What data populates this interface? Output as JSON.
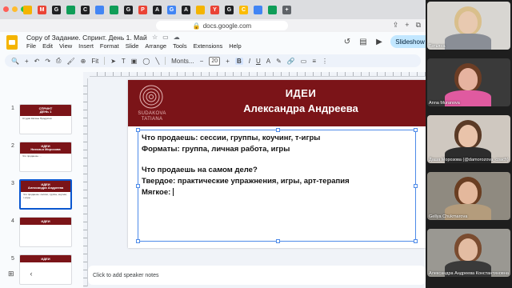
{
  "browser": {
    "url": "docs.google.com",
    "tabs": [
      {
        "color": "#f4b400",
        "glyph": ""
      },
      {
        "color": "#ea4335",
        "glyph": "M"
      },
      {
        "color": "#202124",
        "glyph": "G"
      },
      {
        "color": "#0f9d58",
        "glyph": ""
      },
      {
        "color": "#202124",
        "glyph": "C"
      },
      {
        "color": "#4285f4",
        "glyph": ""
      },
      {
        "color": "#0f9d58",
        "glyph": ""
      },
      {
        "color": "#202124",
        "glyph": "G"
      },
      {
        "color": "#ea4335",
        "glyph": "P"
      },
      {
        "color": "#202124",
        "glyph": "A"
      },
      {
        "color": "#4285f4",
        "glyph": "G"
      },
      {
        "color": "#202124",
        "glyph": "A"
      },
      {
        "color": "#f4b400",
        "glyph": ""
      },
      {
        "color": "#ea4335",
        "glyph": "Y"
      },
      {
        "color": "#202124",
        "glyph": "G"
      },
      {
        "color": "#fbbc04",
        "glyph": "C"
      },
      {
        "color": "#4285f4",
        "glyph": ""
      },
      {
        "color": "#0f9d58",
        "glyph": ""
      },
      {
        "color": "#5f6368",
        "glyph": "+"
      }
    ]
  },
  "doc": {
    "title": "Copy of Задание. Спринт. День 1. Май",
    "menu": [
      "File",
      "Edit",
      "View",
      "Insert",
      "Format",
      "Slide",
      "Arrange",
      "Tools",
      "Extensions",
      "Help"
    ],
    "slideshow_label": "Slideshow"
  },
  "toolbar": {
    "zoom": "Fit",
    "font": "Monts...",
    "font_size": "20",
    "bold": "B"
  },
  "filmstrip": [
    {
      "num": "1",
      "title": "СПРИНТ",
      "subtitle": "ДЕНЬ 1",
      "body": "Студия Катины Продуктов"
    },
    {
      "num": "2",
      "title": "ИДЕИ",
      "subtitle": "Наталья Морозова",
      "body": "Что продаешь: ..."
    },
    {
      "num": "3",
      "title": "ИДЕИ",
      "subtitle": "Александра Андреева",
      "body": "Что продаешь: сессии, группы, коучинг, т-игры"
    },
    {
      "num": "4",
      "title": "ИДЕИ",
      "subtitle": "",
      "body": ""
    },
    {
      "num": "5",
      "title": "ИДЕИ",
      "subtitle": "",
      "body": ""
    }
  ],
  "slide": {
    "brand_line1": "SUDAKOVA",
    "brand_line2": "TATIANA",
    "heading": "ИДЕИ",
    "name": "Александра Андреева",
    "lines": [
      "Что продаешь: сессии, группы, коучинг, т-игры",
      "Форматы: группа, личная работа, игры",
      "",
      "Что продаешь на самом деле?",
      "Твердое: практические упражнения, игры, арт-терапия",
      "Мягкое:"
    ]
  },
  "notes_placeholder": "Click to add speaker notes",
  "participants": [
    {
      "name": "Татьяна",
      "bg": "#d8d6d2",
      "skin": "#e8c9b0",
      "hair": "#d9bf8c",
      "shirt": "#8a8e96"
    },
    {
      "name": "Anna Muranova",
      "bg": "#3a3a3a",
      "skin": "#e6b3a0",
      "hair": "#6b3d25",
      "shirt": "#e05aa0"
    },
    {
      "name": "Даша Морозова (@damorozova_coach)",
      "bg": "#cfc8c0",
      "skin": "#e9c3aa",
      "hair": "#5a3a26",
      "shirt": "#2d2d2d"
    },
    {
      "name": "Gellya Chukmarova",
      "bg": "#8f8a80",
      "skin": "#e4b89c",
      "hair": "#6a3e22",
      "shirt": "#b49c7c"
    },
    {
      "name": "Александра Андреева Константиновна",
      "bg": "#9a9892",
      "skin": "#e3bca2",
      "hair": "#7a4c30",
      "shirt": "#3a3a3a"
    }
  ]
}
